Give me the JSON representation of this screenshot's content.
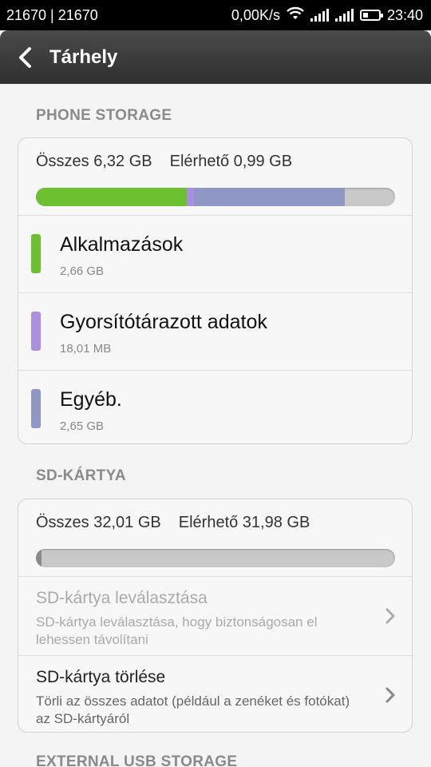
{
  "status_bar": {
    "left_text": "21670 | 21670",
    "speed": "0,00K/s",
    "time": "23:40"
  },
  "header": {
    "title": "Tárhely"
  },
  "phone_storage": {
    "section_title": "PHONE STORAGE",
    "total": "Összes 6,32 GB",
    "available": "Elérhető 0,99 GB",
    "usage_fractions": {
      "apps": 0.42,
      "cache": 0.02,
      "other": 0.42,
      "free": 0.14
    },
    "items": [
      {
        "label": "Alkalmazások",
        "size": "2,66 GB",
        "color": "#6cbf2e"
      },
      {
        "label": "Gyorsítótárazott adatok",
        "size": "18,01 MB",
        "color": "#a98fe0"
      },
      {
        "label": "Egyéb.",
        "size": "2,65 GB",
        "color": "#8f97c4"
      }
    ]
  },
  "sd_card": {
    "section_title": "SD-KÁRTYA",
    "total": "Összes 32,01 GB",
    "available": "Elérhető 31,98 GB",
    "used_fraction": 0.002,
    "actions": [
      {
        "title": "SD-kártya leválasztása",
        "desc": "SD-kártya leválasztása, hogy biztonságosan el lehessen távolítani",
        "enabled": false
      },
      {
        "title": "SD-kártya törlése",
        "desc": "Törli az összes adatot (például a zenéket és fotókat) az SD-kártyáról",
        "enabled": true
      }
    ]
  },
  "usb_storage": {
    "section_title": "EXTERNAL USB STORAGE"
  },
  "colors": {
    "apps": "#6cbf2e",
    "cache": "#a98fe0",
    "other": "#8f97c4",
    "free": "#c8c8c8"
  }
}
